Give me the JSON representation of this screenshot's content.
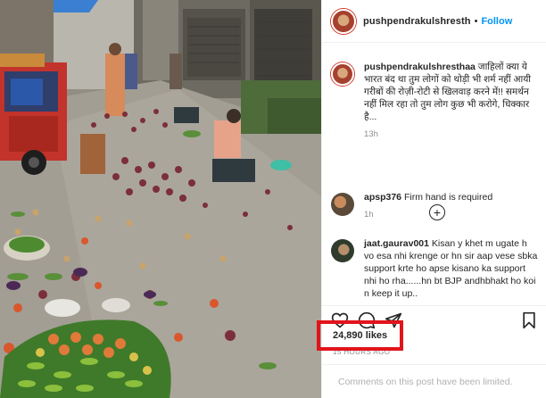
{
  "post": {
    "author": "pushpendrakulshresth",
    "separator": "•",
    "follow_label": "Follow"
  },
  "comments": [
    {
      "user": "pushpendrakulshresthaa",
      "text": "जाहिलों क्या ये भारत बंद था तुम लोगों को थोड़ी भी शर्म नहीं आयी गरीबों की रोज़ी-रोटी से खिलवाड़ करने में!! समर्थन नहीं मिल रहा तो तुम लोग कुछ भी करोगे, धिक्कार है...",
      "time": "13h"
    },
    {
      "user": "apsp376",
      "text": "Firm hand is required",
      "time": "1h"
    },
    {
      "user": "jaat.gaurav001",
      "text": "Kisan y khet m ugate h vo esa nhi krenge or hn sir aap vese sbka support krte ho apse kisano ka support nhi ho rha......hn bt BJP andhbhakt ho koi n keep it up..",
      "time": ""
    }
  ],
  "load_more_icon": "plus-circle-icon",
  "actions": {
    "like_icon": "heart-icon",
    "comment_icon": "comment-icon",
    "share_icon": "paper-plane-icon",
    "save_icon": "bookmark-icon"
  },
  "likes_text": "24,890 likes",
  "posted_text": "15 HOURS AGO",
  "limited_text": "Comments on this post have been limited.",
  "highlight_color": "#e2141b",
  "link_color": "#0095f6"
}
